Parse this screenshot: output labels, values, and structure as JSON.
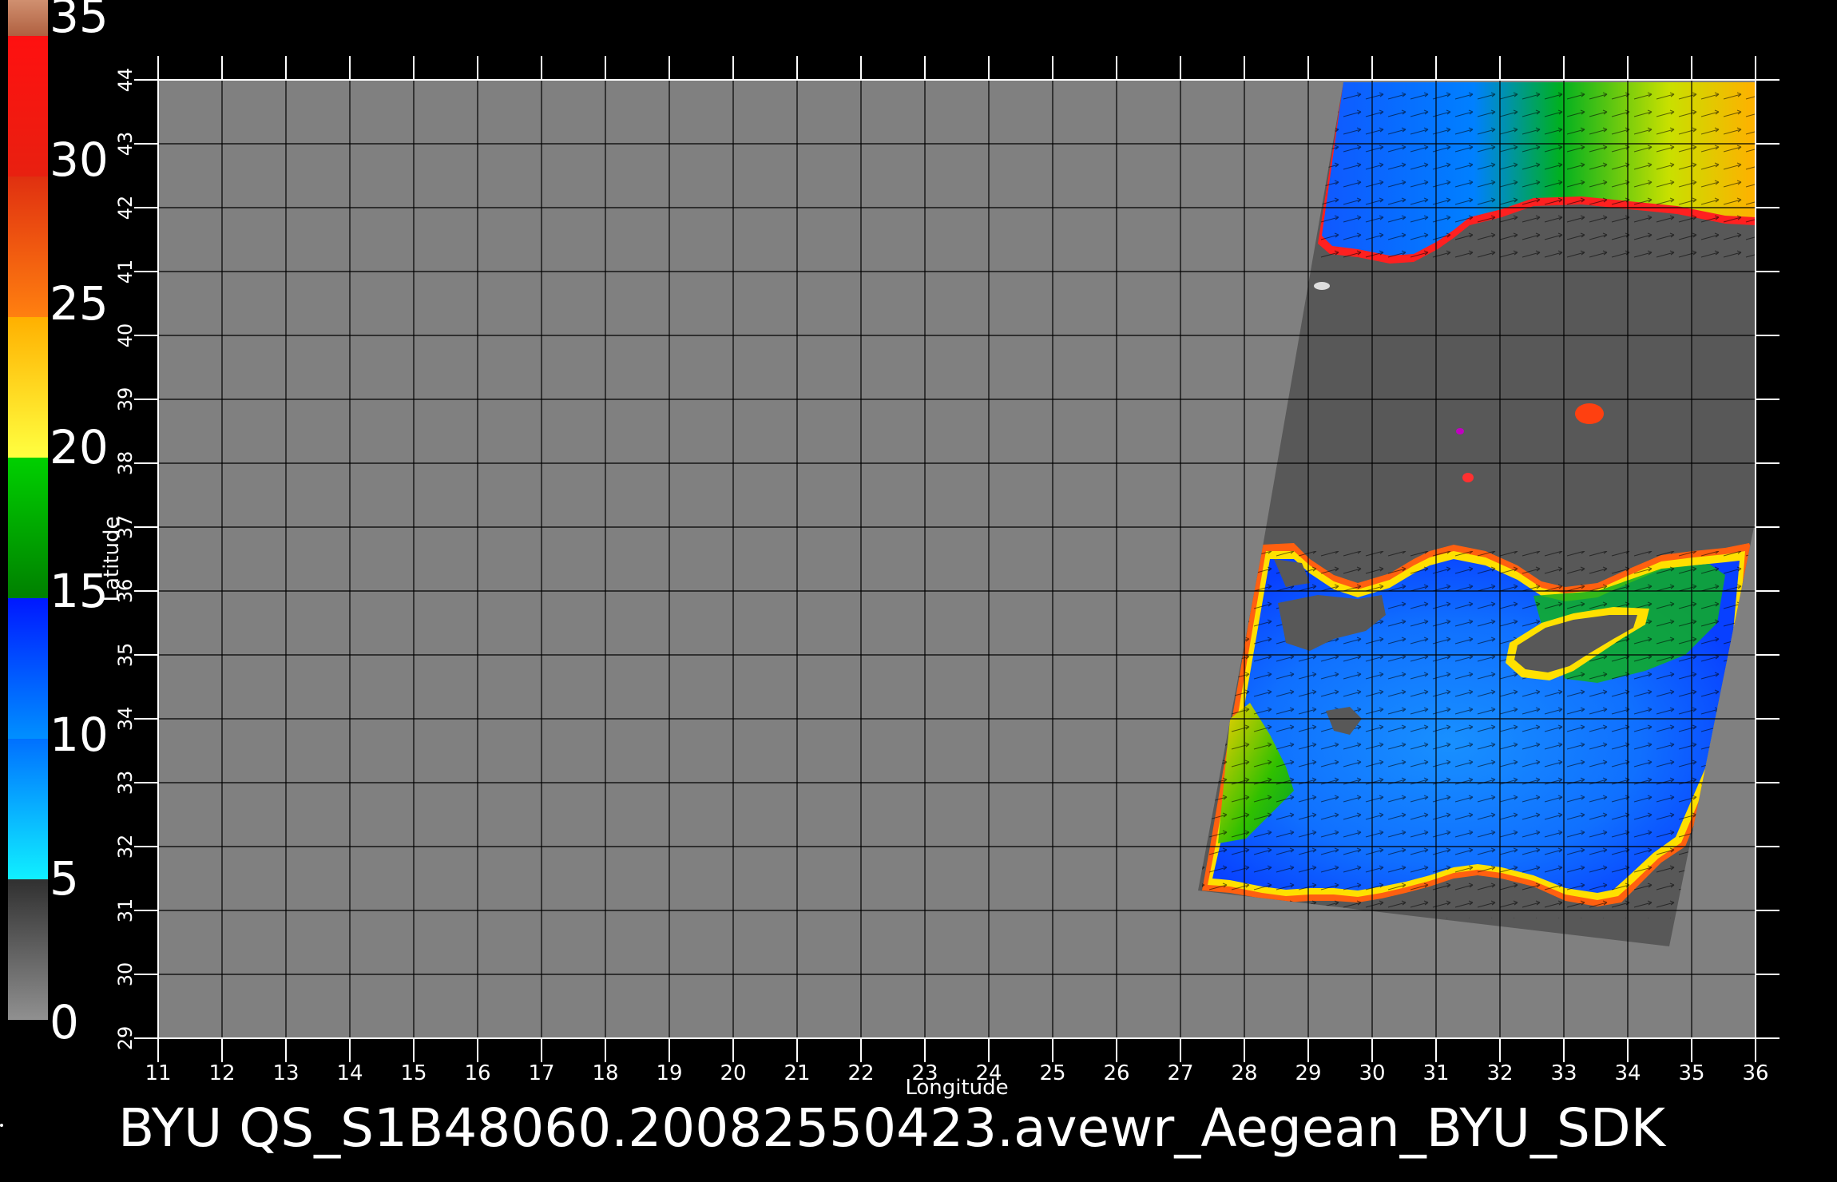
{
  "footer": {
    "title": "BYU  QS_S1B48060.20082550423.avewr_Aegean_BYU_SDK"
  },
  "colorbar": {
    "labels": [
      "35",
      "30",
      "25",
      "20",
      "15",
      "10",
      "5",
      "0"
    ],
    "colors": {
      "c0_5": "#606060",
      "c5_10": "#22c8ff",
      "c10_15": "#1048ff",
      "c15_20": "#00b400",
      "c20_25": "#ffe000",
      "c25_30": "#ff5010",
      "c30_35": "#ff1010",
      "c35_plus": "#b06040"
    }
  },
  "axes": {
    "x_label": "Longitude",
    "y_label": "Latitude",
    "x_range": [
      11,
      36
    ],
    "y_range": [
      29,
      44
    ],
    "x_ticks": [
      "11",
      "12",
      "13",
      "14",
      "15",
      "16",
      "17",
      "18",
      "19",
      "20",
      "21",
      "22",
      "23",
      "24",
      "25",
      "26",
      "27",
      "28",
      "29",
      "30",
      "31",
      "32",
      "33",
      "34",
      "35",
      "36"
    ],
    "y_ticks": [
      "29",
      "30",
      "31",
      "32",
      "33",
      "34",
      "35",
      "36",
      "37",
      "38",
      "39",
      "40",
      "41",
      "42",
      "43",
      "44"
    ],
    "grid": true
  },
  "map": {
    "background_color": "#808080",
    "swath_land_color": "#585858",
    "sea_colors": {
      "calm": "#1070ff",
      "moderate": "#00b000",
      "strong": "#ffd000"
    }
  }
}
